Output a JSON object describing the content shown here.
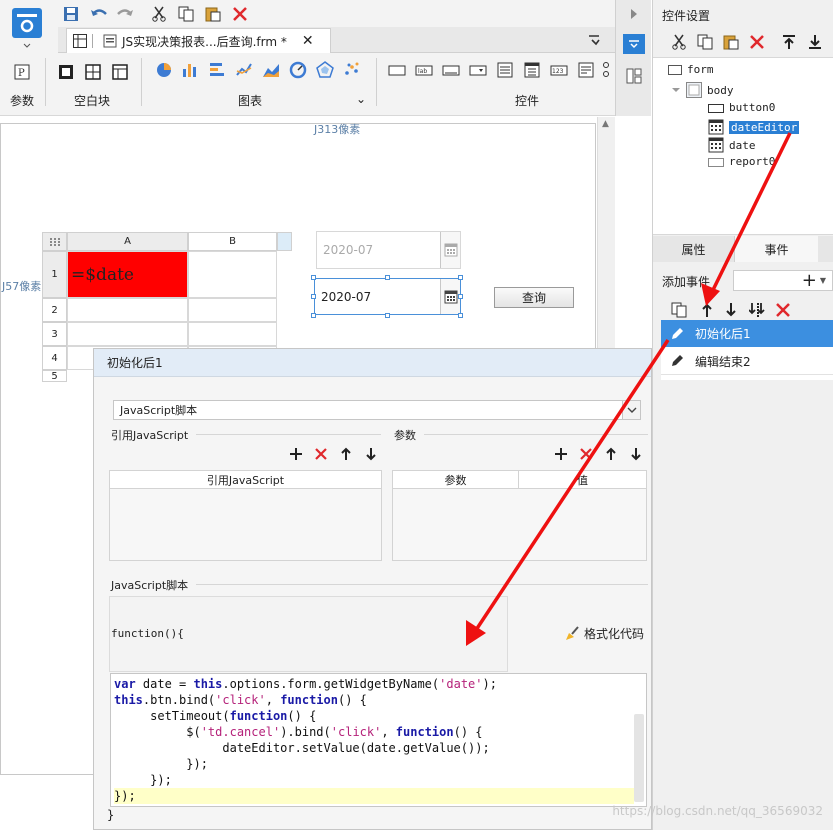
{
  "toolbar": {
    "tab_title": "JS实现决策报表...后查询.frm *",
    "groups": {
      "params": "参数",
      "blank": "空白块",
      "chart": "图表",
      "widgets": "控件"
    }
  },
  "canvas": {
    "ruler_h": "J313像素",
    "ruler_v": "J57像素",
    "grid": {
      "col_headers": [
        "A",
        "B"
      ],
      "row_headers": [
        "1",
        "2",
        "3",
        "4",
        "5"
      ],
      "cell_a1": "=$date"
    },
    "date1_value": "2020-07",
    "date2_value": "2020-07",
    "query_button": "查询"
  },
  "right_panel": {
    "title": "控件设置",
    "tree": {
      "form": "form",
      "body": "body",
      "items": [
        "button0",
        "dateEditor",
        "date",
        "report0"
      ]
    },
    "tabs": {
      "props": "属性",
      "events": "事件"
    },
    "add_event_label": "添加事件",
    "events": [
      "初始化后1",
      "编辑结束2"
    ]
  },
  "dialog": {
    "title": "初始化后1",
    "lang_select": "JavaScript脚本",
    "ref_js_label": "引用JavaScript",
    "params_label": "参数",
    "ref_js_col": "引用JavaScript",
    "params_cols": [
      "参数",
      "值"
    ],
    "script_label": "JavaScript脚本",
    "function_header": "function(){",
    "format_code": "格式化代码",
    "closing_brace": "}"
  },
  "code_lines": [
    [
      {
        "t": "var",
        "c": "kw"
      },
      {
        "t": " date = ",
        "c": "pl"
      },
      {
        "t": "this",
        "c": "kw"
      },
      {
        "t": ".options.form.getWidgetByName(",
        "c": "pl"
      },
      {
        "t": "'date'",
        "c": "st"
      },
      {
        "t": ");",
        "c": "pl"
      }
    ],
    [
      {
        "t": "this",
        "c": "kw"
      },
      {
        "t": ".btn.bind(",
        "c": "pl"
      },
      {
        "t": "'click'",
        "c": "st"
      },
      {
        "t": ", ",
        "c": "pl"
      },
      {
        "t": "function",
        "c": "kw"
      },
      {
        "t": "() {",
        "c": "pl"
      }
    ],
    [
      {
        "t": "     setTimeout(",
        "c": "pl"
      },
      {
        "t": "function",
        "c": "kw"
      },
      {
        "t": "() {",
        "c": "pl"
      }
    ],
    [
      {
        "t": "          $(",
        "c": "pl"
      },
      {
        "t": "'td.cancel'",
        "c": "st"
      },
      {
        "t": ").bind(",
        "c": "pl"
      },
      {
        "t": "'click'",
        "c": "st"
      },
      {
        "t": ", ",
        "c": "pl"
      },
      {
        "t": "function",
        "c": "kw"
      },
      {
        "t": "() {",
        "c": "pl"
      }
    ],
    [
      {
        "t": "               dateEditor.setValue(date.getValue());",
        "c": "pl"
      }
    ],
    [
      {
        "t": "          });",
        "c": "pl"
      }
    ],
    [
      {
        "t": "     });",
        "c": "pl"
      }
    ],
    [
      {
        "t": "});",
        "c": "pl"
      }
    ]
  ],
  "watermark": "https://blog.csdn.net/qq_36569032"
}
